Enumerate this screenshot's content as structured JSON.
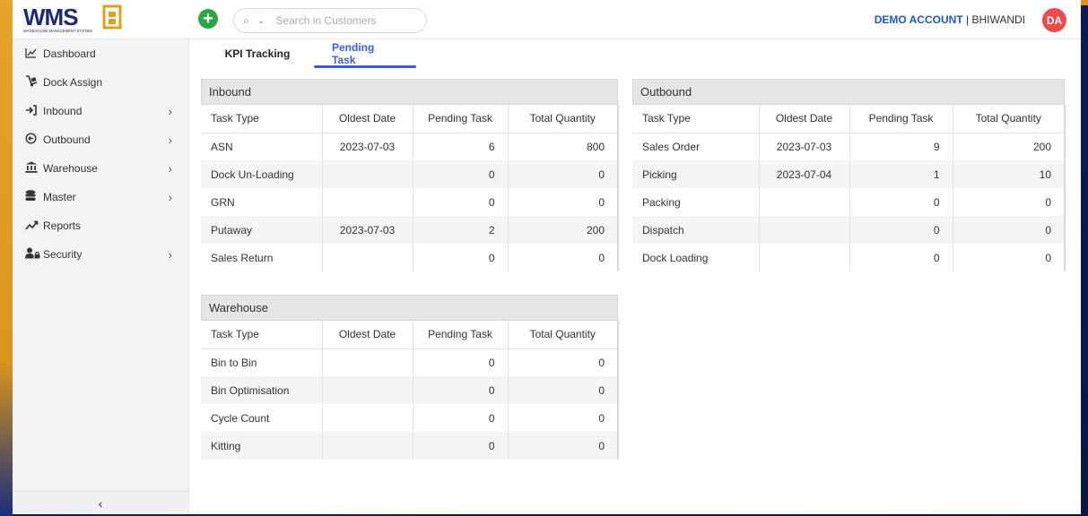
{
  "header": {
    "logo_text": "WMS",
    "logo_subtitle": "WAREHOUSE MANAGEMENT SYSTEM",
    "add_label": "+",
    "search": {
      "placeholder": "Search in Customers",
      "value": ""
    },
    "account_name": "DEMO ACCOUNT",
    "account_separator": " | ",
    "account_location": "BHIWANDI",
    "avatar_initials": "DA",
    "colors": {
      "accent": "#1e5bb8",
      "avatar": "#ee4a4a",
      "add": "#28a745"
    }
  },
  "sidebar": {
    "items": [
      {
        "label": "Dashboard",
        "icon": "chart-line-icon",
        "has_children": false
      },
      {
        "label": "Dock Assign",
        "icon": "dolly-icon",
        "has_children": false
      },
      {
        "label": "Inbound",
        "icon": "sign-in-icon",
        "has_children": true
      },
      {
        "label": "Outbound",
        "icon": "arrow-circle-left-icon",
        "has_children": true
      },
      {
        "label": "Warehouse",
        "icon": "building-columns-icon",
        "has_children": true
      },
      {
        "label": "Master",
        "icon": "database-icon",
        "has_children": true
      },
      {
        "label": "Reports",
        "icon": "trend-up-icon",
        "has_children": false
      },
      {
        "label": "Security",
        "icon": "user-lock-icon",
        "has_children": true
      }
    ],
    "collapse_label": "‹"
  },
  "tabs": [
    {
      "label": "KPI Tracking",
      "active": false
    },
    {
      "label": "Pending Task",
      "active": true
    }
  ],
  "columns": [
    "Task Type",
    "Oldest Date",
    "Pending Task",
    "Total Quantity"
  ],
  "inbound": {
    "title": "Inbound",
    "rows": [
      [
        "ASN",
        "2023-07-03",
        "6",
        "800"
      ],
      [
        "Dock Un-Loading",
        "",
        "0",
        "0"
      ],
      [
        "GRN",
        "",
        "0",
        "0"
      ],
      [
        "Putaway",
        "2023-07-03",
        "2",
        "200"
      ],
      [
        "Sales Return",
        "",
        "0",
        "0"
      ]
    ]
  },
  "outbound": {
    "title": "Outbound",
    "rows": [
      [
        "Sales Order",
        "2023-07-03",
        "9",
        "200"
      ],
      [
        "Picking",
        "2023-07-04",
        "1",
        "10"
      ],
      [
        "Packing",
        "",
        "0",
        "0"
      ],
      [
        "Dispatch",
        "",
        "0",
        "0"
      ],
      [
        "Dock Loading",
        "",
        "0",
        "0"
      ]
    ]
  },
  "warehouse": {
    "title": "Warehouse",
    "rows": [
      [
        "Bin to Bin",
        "",
        "0",
        "0"
      ],
      [
        "Bin Optimisation",
        "",
        "0",
        "0"
      ],
      [
        "Cycle Count",
        "",
        "0",
        "0"
      ],
      [
        "Kitting",
        "",
        "0",
        "0"
      ]
    ]
  }
}
